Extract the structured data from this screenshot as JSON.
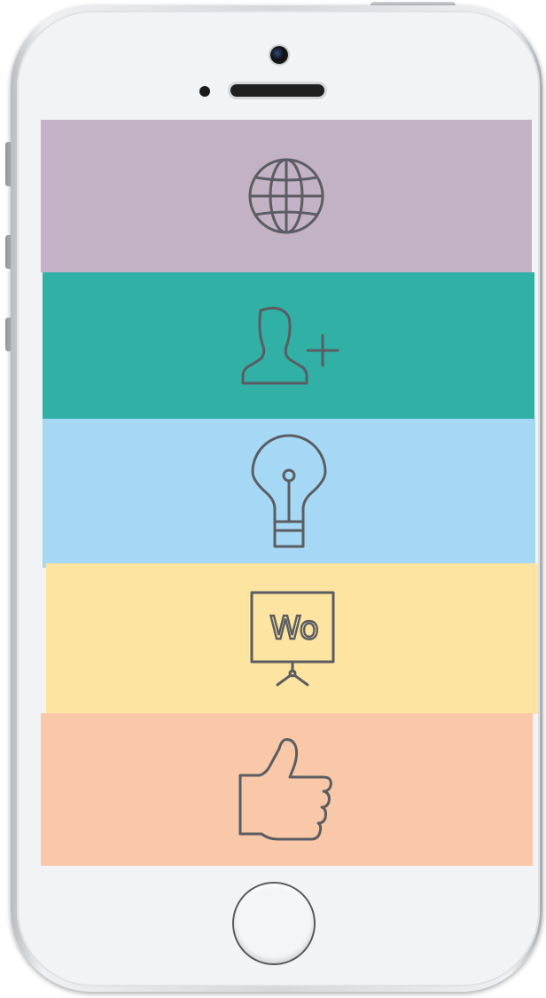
{
  "device": {
    "frame_color": "#e9ebed",
    "screen_background": "#f2f3f5"
  },
  "menu": {
    "icon_stroke_color": "#5b5d62",
    "items": [
      {
        "name": "globe",
        "icon": "globe-icon",
        "color": "#c3b1c6"
      },
      {
        "name": "add-user",
        "icon": "user-plus-icon",
        "color": "#31b0a5"
      },
      {
        "name": "idea",
        "icon": "lightbulb-icon",
        "color": "#a5d8f5"
      },
      {
        "name": "presentation",
        "icon": "presentation-board-icon",
        "color": "#fde4a0"
      },
      {
        "name": "like",
        "icon": "thumbs-up-icon",
        "color": "#f8c8a8"
      }
    ]
  },
  "board": {
    "text": "Wo"
  }
}
